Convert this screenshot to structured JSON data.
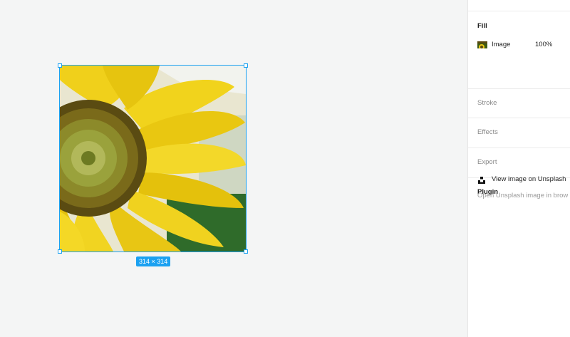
{
  "canvas": {
    "selection_size": "314 × 314"
  },
  "panel": {
    "fill": {
      "title": "Fill",
      "type_label": "Image",
      "opacity": "100%"
    },
    "stroke": {
      "title": "Stroke"
    },
    "effects": {
      "title": "Effects"
    },
    "export": {
      "title": "Export"
    },
    "plugin": {
      "title": "Plugin",
      "action_label": "View image on Unsplash",
      "description": "Open Unsplash image in brow"
    }
  },
  "colors": {
    "selection": "#1ba1f1",
    "canvas_bg": "#f4f5f5",
    "panel_bg": "#ffffff"
  },
  "icons": {
    "plugin": "unsplash-icon",
    "fill_thumb": "image-thumbnail-icon"
  }
}
